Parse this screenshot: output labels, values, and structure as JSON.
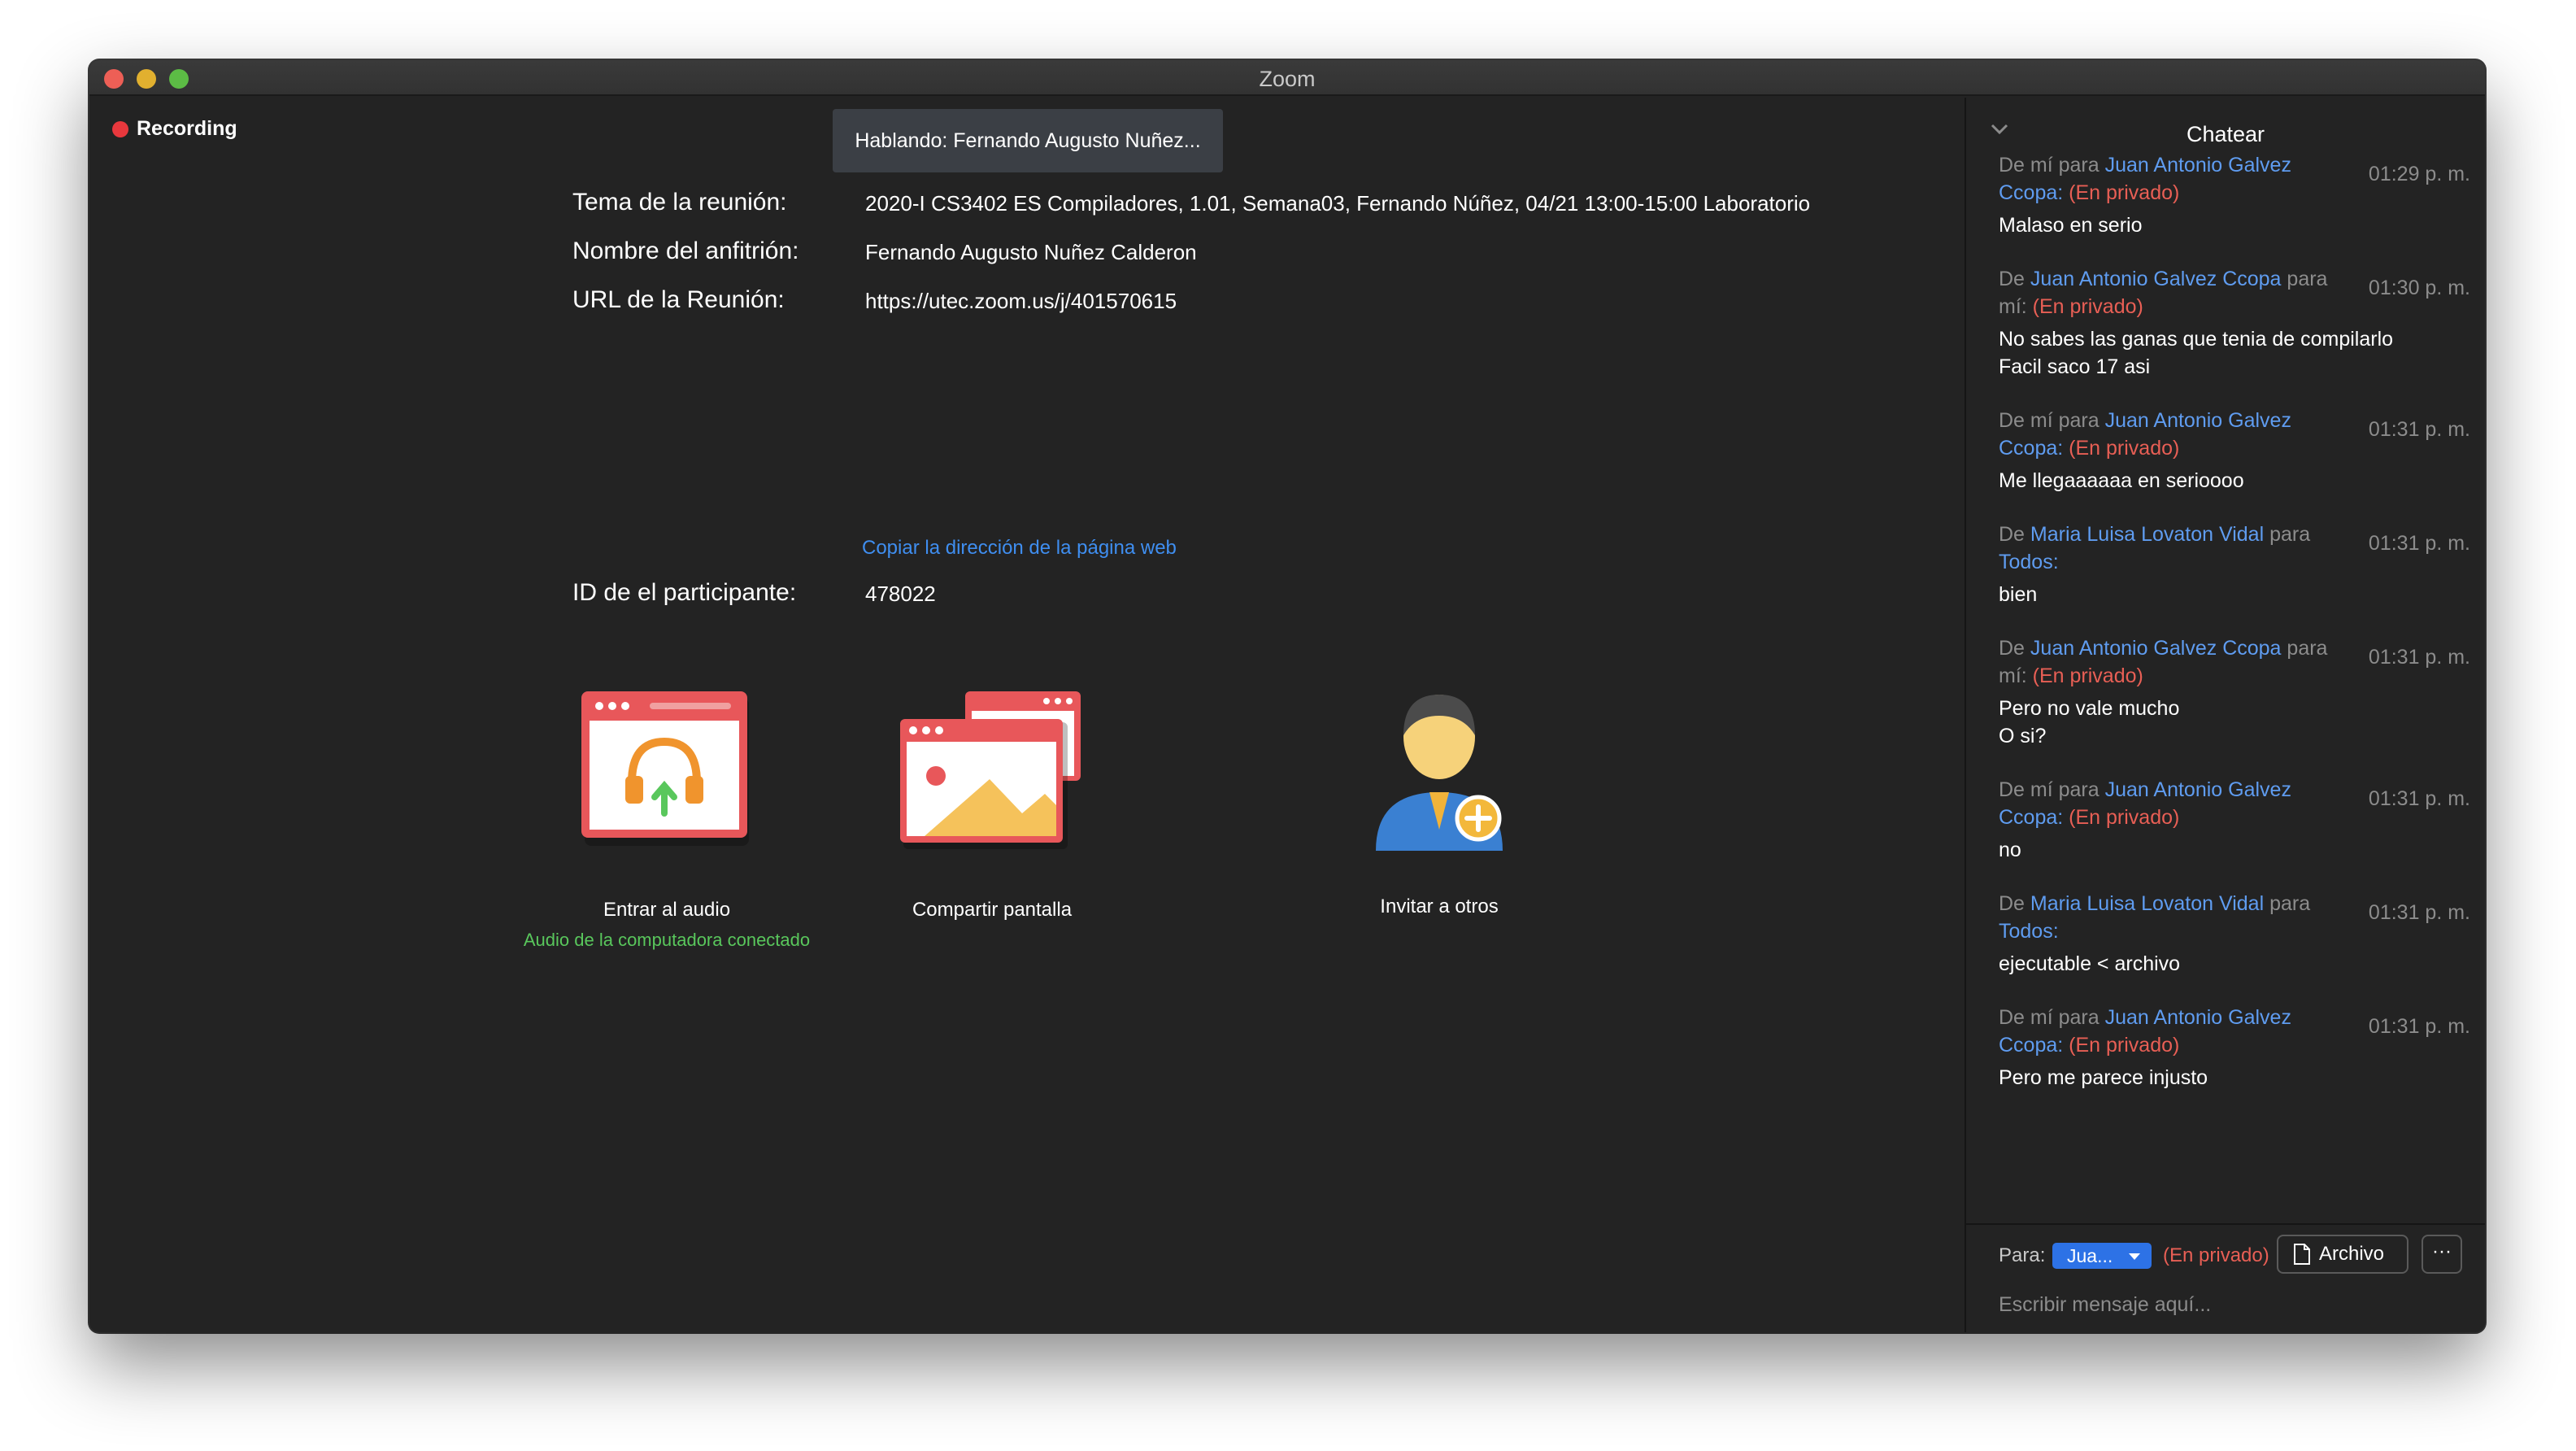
{
  "window": {
    "title": "Zoom"
  },
  "recording": {
    "label": "Recording"
  },
  "speaking": {
    "label": "Hablando: Fernando Augusto Nuñez..."
  },
  "meeting": {
    "topic_label": "Tema de la reunión:",
    "topic_value": "2020-I CS3402 ES Compiladores, 1.01, Semana03, Fernando Núñez, 04/21 13:00-15:00 Laboratorio",
    "host_label": "Nombre del anfitrión:",
    "host_value": "Fernando Augusto Nuñez Calderon",
    "url_label": "URL de la Reunión:",
    "url_value": "https://utec.zoom.us/j/401570615",
    "copy_link": "Copiar la dirección de la página web",
    "participant_label": "ID de el participante:",
    "participant_value": "478022"
  },
  "actions": {
    "audio": {
      "label": "Entrar al audio",
      "status": "Audio de la computadora conectado",
      "icon": "headphones-upload-icon"
    },
    "share": {
      "label": "Compartir pantalla",
      "icon": "share-screen-icon"
    },
    "invite": {
      "label": "Invitar a otros",
      "icon": "invite-person-icon"
    }
  },
  "chat": {
    "title": "Chatear",
    "messages": [
      {
        "prefix": "De mí para",
        "who": "Juan Antonio Galvez Ccopa:",
        "mid": "",
        "target": "",
        "priv": "(En privado)",
        "time": "01:29 p. m.",
        "lines": [
          "Malaso en serio"
        ]
      },
      {
        "prefix": "De",
        "who": "Juan Antonio Galvez Ccopa",
        "mid": "para mí:",
        "target": "",
        "priv": "(En privado)",
        "time": "01:30 p. m.",
        "lines": [
          "No sabes las ganas que tenia de compilarlo",
          "Facil saco 17 asi"
        ]
      },
      {
        "prefix": "De mí para",
        "who": "Juan Antonio Galvez Ccopa:",
        "mid": "",
        "target": "",
        "priv": "(En privado)",
        "time": "01:31 p. m.",
        "lines": [
          "Me llegaaaaaa en serioooo"
        ]
      },
      {
        "prefix": "De",
        "who": "Maria Luisa Lovaton Vidal",
        "mid": "para",
        "target": "Todos:",
        "priv": "",
        "time": "01:31 p. m.",
        "lines": [
          "bien"
        ]
      },
      {
        "prefix": "De",
        "who": "Juan Antonio Galvez Ccopa",
        "mid": "para mí:",
        "target": "",
        "priv": "(En privado)",
        "time": "01:31 p. m.",
        "lines": [
          "Pero no vale mucho",
          "O si?"
        ]
      },
      {
        "prefix": "De mí para",
        "who": "Juan Antonio Galvez Ccopa:",
        "mid": "",
        "target": "",
        "priv": "(En privado)",
        "time": "01:31 p. m.",
        "lines": [
          "no"
        ]
      },
      {
        "prefix": "De",
        "who": "Maria Luisa Lovaton Vidal",
        "mid": "para",
        "target": "Todos:",
        "priv": "",
        "time": "01:31 p. m.",
        "lines": [
          "ejecutable < archivo"
        ]
      },
      {
        "prefix": "De mí para",
        "who": "Juan Antonio Galvez Ccopa:",
        "mid": "",
        "target": "",
        "priv": "(En privado)",
        "time": "01:31 p. m.",
        "lines": [
          "Pero me parece injusto"
        ]
      }
    ],
    "composer": {
      "to_label": "Para:",
      "recipient": "Jua...",
      "private_tag": "(En privado)",
      "file_label": "Archivo",
      "more_label": "···",
      "placeholder": "Escribir mensaje aquí..."
    }
  }
}
